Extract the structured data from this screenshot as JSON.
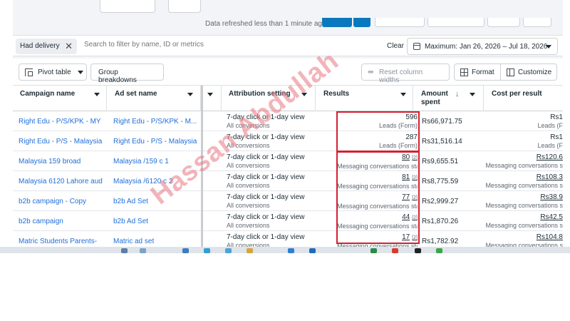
{
  "header": {
    "data_refreshed": "Data refreshed less than 1 minute ago"
  },
  "filter": {
    "chip_label": "Had delivery",
    "search_placeholder": "Search to filter by name, ID or metrics",
    "clear_label": "Clear",
    "date_range": "Maximum: Jan 26, 2026 – Jul 18, 2026"
  },
  "toolbar": {
    "pivot_label": "Pivot table",
    "group_label": "Group breakdowns",
    "reset_label": "Reset column widths",
    "format_label": "Format",
    "customize_label": "Customize"
  },
  "columns": {
    "campaign": "Campaign name",
    "adset": "Ad set name",
    "attribution": "Attribution setting",
    "results": "Results",
    "amount": "Amount spent",
    "cpr": "Cost per result"
  },
  "rows": [
    {
      "campaign": "Right Edu - P/S/KPK - MY",
      "adset": "Right Edu - P/S/KPK - M...",
      "attr1": "7-day click or 1-day view",
      "attr2": "All conversions",
      "result": "596",
      "ref": "",
      "result_type": "Leads (Form)",
      "amount": "Rs66,971.75",
      "cpr": "Rs1",
      "cpr_type": "Leads (F"
    },
    {
      "campaign": "Right Edu - P/S - Malaysia",
      "adset": "Right Edu - P/S - Malaysia",
      "attr1": "7-day click or 1-day view",
      "attr2": "All conversions",
      "result": "287",
      "ref": "",
      "result_type": "Leads (Form)",
      "amount": "Rs31,516.14",
      "cpr": "Rs1",
      "cpr_type": "Leads (F"
    },
    {
      "campaign": "Malaysia 159 broad",
      "adset": "Malaysia /159 c 1",
      "attr1": "7-day click or 1-day view",
      "attr2": "All conversions",
      "result": "80",
      "ref": "[2]",
      "result_type": "Messaging conversations started",
      "amount": "Rs9,655.51",
      "cpr": "Rs120.6",
      "cpr_type": "Messaging conversations s"
    },
    {
      "campaign": "Malaysia 6120 Lahore aud",
      "adset": "Malaysia /6120 c 2",
      "attr1": "7-day click or 1-day view",
      "attr2": "All conversions",
      "result": "81",
      "ref": "[2]",
      "result_type": "Messaging conversations started",
      "amount": "Rs8,775.59",
      "cpr": "Rs108.3",
      "cpr_type": "Messaging conversations s"
    },
    {
      "campaign": "b2b campaign - Copy",
      "adset": "b2b Ad Set",
      "attr1": "7-day click or 1-day view",
      "attr2": "All conversions",
      "result": "77",
      "ref": "[2]",
      "result_type": "Messaging conversations started",
      "amount": "Rs2,999.27",
      "cpr": "Rs38.9",
      "cpr_type": "Messaging conversations s"
    },
    {
      "campaign": "b2b campaign",
      "adset": "b2b Ad Set",
      "attr1": "7-day click or 1-day view",
      "attr2": "All conversions",
      "result": "44",
      "ref": "[2]",
      "result_type": "Messaging conversations started",
      "amount": "Rs1,870.26",
      "cpr": "Rs42.5",
      "cpr_type": "Messaging conversations s"
    },
    {
      "campaign": "Matric Students Parents-",
      "adset": "Matric ad set",
      "attr1": "7-day click or 1-day view",
      "attr2": "All conversions",
      "result": "17",
      "ref": "[2]",
      "result_type": "Messaging conversations started",
      "amount": "Rs1,782.92",
      "cpr": "Rs104.8",
      "cpr_type": "Messaging conversations s"
    }
  ],
  "watermark": "Hassan Abdullah",
  "colors": {
    "accent": "#0a78be",
    "link": "#216fdb",
    "highlight_box": "#d32030",
    "watermark": "#e87682"
  },
  "icons": [
    "close-icon",
    "calendar-icon",
    "chevron-down-icon",
    "pivot-table-icon",
    "reset-columns-icon",
    "format-icon",
    "customize-icon",
    "sort-arrow-icon"
  ]
}
